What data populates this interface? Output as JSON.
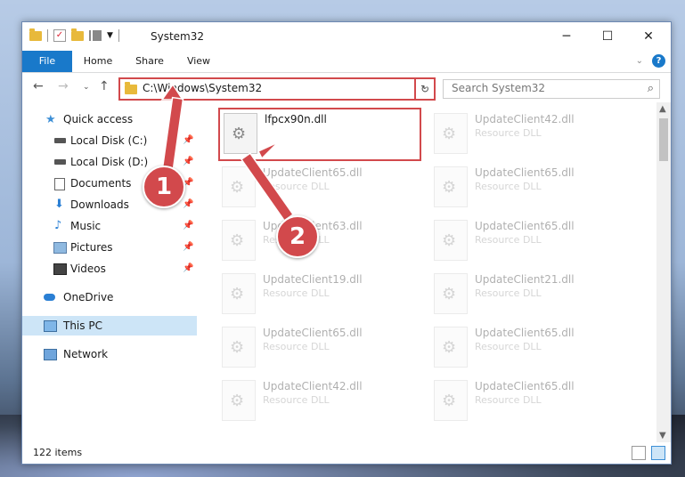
{
  "window": {
    "title": "System32",
    "caption": {
      "minimize": "─",
      "maximize": "☐",
      "close": "✕"
    }
  },
  "ribbon": {
    "tabs": [
      "File",
      "Home",
      "Share",
      "View"
    ],
    "collapse_icon": "chevron-down-icon",
    "help_icon": "?"
  },
  "address_bar": {
    "path": "C:\\Windows\\System32",
    "refresh_icon": "↻"
  },
  "search": {
    "placeholder": "Search System32",
    "icon": "⌕"
  },
  "sidebar": {
    "items": [
      {
        "label": "Quick access",
        "icon": "star-icon"
      },
      {
        "label": "Local Disk (C:)",
        "icon": "drive-icon",
        "pinned": true
      },
      {
        "label": "Local Disk (D:)",
        "icon": "drive-icon",
        "pinned": true
      },
      {
        "label": "Documents",
        "icon": "documents-icon",
        "pinned": true
      },
      {
        "label": "Downloads",
        "icon": "download-icon",
        "pinned": true
      },
      {
        "label": "Music",
        "icon": "music-icon",
        "pinned": true
      },
      {
        "label": "Pictures",
        "icon": "pictures-icon",
        "pinned": true
      },
      {
        "label": "Videos",
        "icon": "videos-icon",
        "pinned": true
      },
      {
        "label": "OneDrive",
        "icon": "cloud-icon"
      },
      {
        "label": "This PC",
        "icon": "computer-icon",
        "selected": true
      },
      {
        "label": "Network",
        "icon": "network-icon"
      }
    ]
  },
  "files": {
    "highlighted": {
      "name": "lfpcx90n.dll",
      "type": ""
    },
    "items": [
      {
        "name": "UpdateClient42.dll",
        "type": "Resource DLL"
      },
      {
        "name": "UpdateClient65.dll",
        "type": "Resource DLL"
      },
      {
        "name": "UpdateClient65.dll",
        "type": "Resource DLL"
      },
      {
        "name": "UpdateClient63.dll",
        "type": "Resource DLL"
      },
      {
        "name": "UpdateClient65.dll",
        "type": "Resource DLL"
      },
      {
        "name": "UpdateClient19.dll",
        "type": "Resource DLL"
      },
      {
        "name": "UpdateClient21.dll",
        "type": "Resource DLL"
      },
      {
        "name": "UpdateClient65.dll",
        "type": "Resource DLL"
      },
      {
        "name": "UpdateClient65.dll",
        "type": "Resource DLL"
      },
      {
        "name": "UpdateClient42.dll",
        "type": "Resource DLL"
      },
      {
        "name": "UpdateClient65.dll",
        "type": "Resource DLL"
      }
    ]
  },
  "status": {
    "item_count": "122 items"
  },
  "annotations": {
    "step1": "1",
    "step2": "2",
    "color": "#d2494c"
  }
}
